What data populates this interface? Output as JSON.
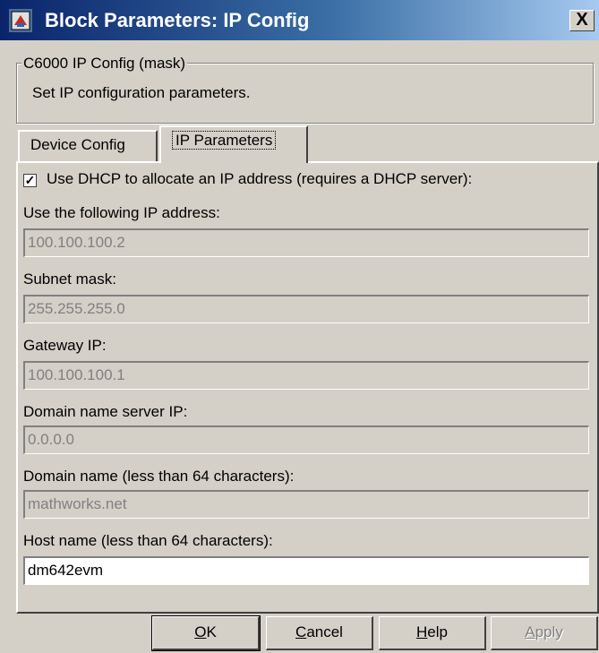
{
  "window": {
    "title": "Block Parameters: IP Config",
    "close_glyph": "X",
    "icon": "simulink-block-icon"
  },
  "mask": {
    "legend": "C6000 IP Config (mask)",
    "description": "Set IP configuration parameters."
  },
  "tabs": [
    {
      "label": "Device Config",
      "active": false
    },
    {
      "label": "IP Parameters",
      "active": true
    }
  ],
  "params": {
    "dhcp": {
      "label": "Use DHCP to allocate an IP address  (requires a DHCP server):",
      "checked": true,
      "check_glyph": "✓"
    },
    "ip_address": {
      "label": "Use the following IP address:",
      "value": "100.100.100.2"
    },
    "subnet": {
      "label": "Subnet mask:",
      "value": "255.255.255.0"
    },
    "gateway": {
      "label": "Gateway IP:",
      "value": "100.100.100.1"
    },
    "dns": {
      "label": "Domain name server IP:",
      "value": "0.0.0.0"
    },
    "domain": {
      "label": "Domain name (less than 64 characters):",
      "value": "mathworks.net"
    },
    "host": {
      "label": "Host name (less than 64 characters):",
      "value": "dm642evm"
    }
  },
  "buttons": {
    "ok": {
      "mnemonic": "O",
      "rest": "K"
    },
    "cancel": {
      "mnemonic": "C",
      "rest": "ancel"
    },
    "help": {
      "mnemonic": "H",
      "rest": "elp"
    },
    "apply": {
      "mnemonic": "A",
      "rest": "pply",
      "disabled": true
    }
  },
  "colors": {
    "titlebar_start": "#0a246a",
    "titlebar_end": "#a6caf0",
    "face": "#d4d0c8",
    "disabled_text": "#808080"
  }
}
